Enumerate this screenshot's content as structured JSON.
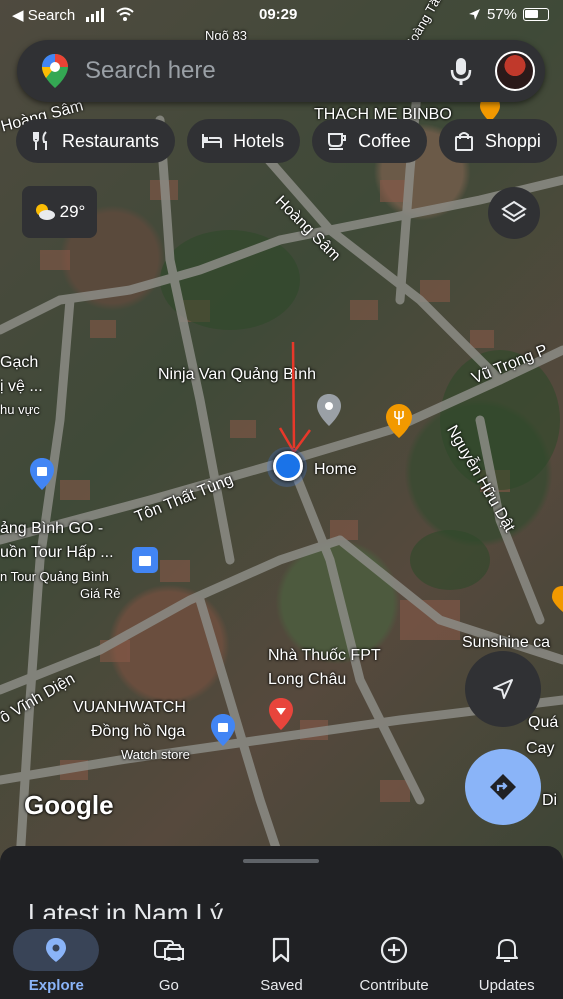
{
  "status": {
    "carrier": "◀ Search",
    "time": "09:29",
    "battery": "57%"
  },
  "search": {
    "placeholder": "Search here"
  },
  "chips": [
    {
      "label": "Restaurants",
      "icon": "fork-knife-icon"
    },
    {
      "label": "Hotels",
      "icon": "bed-icon"
    },
    {
      "label": "Coffee",
      "icon": "coffee-cup-icon"
    },
    {
      "label": "Shoppi",
      "icon": "shopping-bag-icon"
    }
  ],
  "weather": {
    "temp": "29°",
    "icon": "partly-sunny-icon"
  },
  "map_labels": {
    "road_hoang_sam_top": "Hoàng Sâm",
    "road_hoang_sam": "Hoàng Sâm",
    "thach_me": "THẠCH MẸ BINBO",
    "road_nga": "Ngõ 83",
    "road_hoang_tang": "Hoàng Tăng",
    "ninja_van": "Ninja Van Quảng Bình",
    "home": "Home",
    "ton_that_tung": "Tôn Thất Tùng",
    "vu_trong": "Vũ Trọng P",
    "nguyen_huu_dat": "Nguyễn Hữu Dật",
    "gach": "Gạch",
    "dich_ve": "ị vệ ...",
    "khu_vuc": "hu vực",
    "binh_go": "ảng Bình GO -",
    "uon_tour": "uồn Tour Hấp ...",
    "tour_qb": "n Tour Quảng Bình",
    "gia_re": "Giá Rẻ",
    "sunshine": "Sunshine ca",
    "nha_thuoc": "Nhà Thuốc FPT",
    "long_chau": "Long Châu",
    "vinh_dien": "ồ Vĩnh Diện",
    "vuanh": "VUANHWATCH",
    "dong_ho": "Đồng hồ Nga",
    "watch_store": "Watch store",
    "quan": "Quá",
    "cay": "Cay",
    "di": "Di",
    "google": "Google"
  },
  "sheet": {
    "title": "Latest in Nam Lý"
  },
  "nav": [
    {
      "label": "Explore",
      "icon": "location-pin-icon",
      "active": true
    },
    {
      "label": "Go",
      "icon": "car-icon",
      "active": false
    },
    {
      "label": "Saved",
      "icon": "bookmark-icon",
      "active": false
    },
    {
      "label": "Contribute",
      "icon": "add-circle-icon",
      "active": false
    },
    {
      "label": "Updates",
      "icon": "bell-icon",
      "active": false
    }
  ],
  "colors": {
    "accent": "#8ab4f8",
    "location_blue": "#1a73e8",
    "annotation_red": "#e8382a",
    "surface": "#303134"
  }
}
